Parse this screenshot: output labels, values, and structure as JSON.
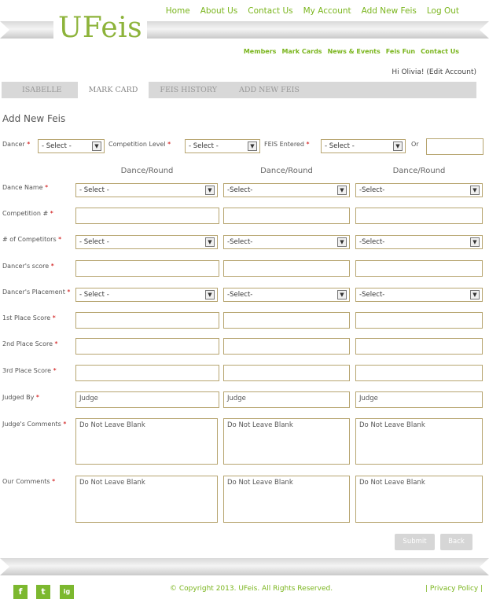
{
  "brand": {
    "logo": "UFeis"
  },
  "topnav": [
    "Home",
    "About Us",
    "Contact Us",
    "My Account",
    "Add New Feis",
    "Log Out"
  ],
  "subnav": [
    "Members",
    "Mark Cards",
    "News & Events",
    "Feis Fun",
    "Contact Us"
  ],
  "greeting": "Hi Olivia! (Edit Account)",
  "tabs": [
    "ISABELLE",
    "MARK CARD",
    "FEIS HISTORY",
    "ADD NEW FEIS"
  ],
  "page_title": "Add New Feis",
  "top_row": {
    "dancer_label": "Dancer",
    "dancer_value": "- Select -",
    "level_label": "Competition Level",
    "level_value": "- Select -",
    "feis_label": "FEIS Entered",
    "feis_value": "- Select -",
    "or_label": "Or",
    "required_mark": "*"
  },
  "column_header": "Dance/Round",
  "rows": [
    {
      "label": "Dance Name"
    },
    {
      "label": "Competition #"
    },
    {
      "label": "# of Competitors"
    },
    {
      "label": "Dancer's score"
    },
    {
      "label": "Dancer's Placement"
    },
    {
      "label": "1st Place Score"
    },
    {
      "label": "2nd Place Score"
    },
    {
      "label": "3rd Place Score"
    },
    {
      "label": "Judged By"
    },
    {
      "label": "Judge's Comments"
    },
    {
      "label": "Our Comments"
    }
  ],
  "select_first": "- Select -",
  "select_other": "-Select-",
  "judge_value": "Judge",
  "comment_value": "Do Not Leave Blank",
  "buttons": {
    "submit": "Submit",
    "back": "Back"
  },
  "footer": {
    "social": [
      "f",
      "t",
      "ig"
    ],
    "copyright": "© Copyright 2013. UFeis. All Rights Reserved.",
    "privacy": "| Privacy Policy |"
  },
  "colors": {
    "accent": "#7ab51d",
    "border": "#b7a570",
    "required": "#cc0000"
  }
}
